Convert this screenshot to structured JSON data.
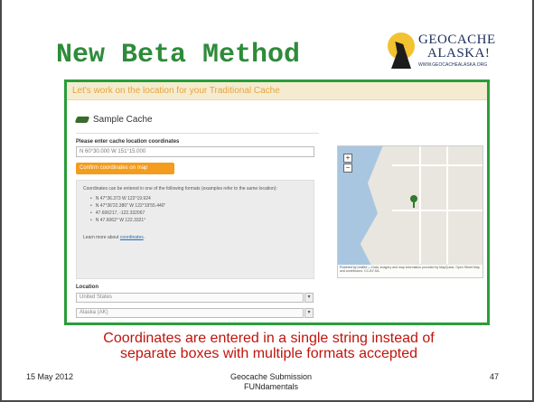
{
  "slide": {
    "title": "New Beta Method",
    "caption_line1": "Coordinates are entered in a single string instead of",
    "caption_line2": "separate boxes with multiple formats accepted"
  },
  "logo": {
    "line1": "GEOCACHE",
    "line2": "ALASKA!",
    "url": "WWW.GEOCACHEALASKA.ORG"
  },
  "screenshot": {
    "header": "Let's work on the location for your Traditional Cache",
    "cache_name": "Sample Cache",
    "coord_label": "Please enter cache location coordinates",
    "coord_value": "N 60°30.000 W 151°15.000",
    "confirm_button": "Confirm coordinates on map",
    "help_intro": "Coordinates can be entered in one of the following formats (examples refer to the same location):",
    "formats": [
      "N 47°36.373 W 122°19.924",
      "N 47°36'22.380\" W 122°19'55.440\"",
      "47.606217, -122.332067",
      "N 47.6062° W 122.3321°"
    ],
    "learn_more_prefix": "Learn more about",
    "learn_more_link": "coordinates",
    "location_label": "Location",
    "country": "United States",
    "state": "Alaska (AK)",
    "map_attribution": "Powered by Leaflet — Data, imagery and map information provided by MapQuest, Open Street Map and contributors, CC-BY-SA."
  },
  "footer": {
    "date": "15 May 2012",
    "center_line1": "Geocache Submission",
    "center_line2": "FUNdamentals",
    "page": "47"
  },
  "colors": {
    "title": "#2e8b3a",
    "caption": "#c0140c",
    "screenshot_border": "#2a9d3a",
    "button": "#f39c1e"
  }
}
